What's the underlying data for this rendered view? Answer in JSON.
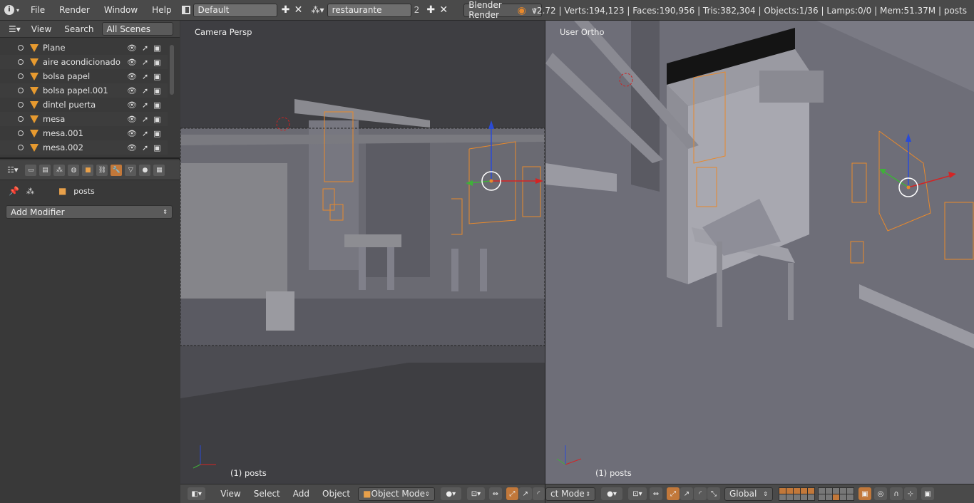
{
  "topbar": {
    "menus": [
      "File",
      "Render",
      "Window",
      "Help"
    ],
    "screen_layout": "Default",
    "scene": "restaurante",
    "scene_users": "2",
    "render_engine": "Blender Render",
    "stats": "v2.72 | Verts:194,123 | Faces:190,956 | Tris:382,304 | Objects:1/36 | Lamps:0/0 | Mem:51.37M | posts"
  },
  "outliner": {
    "menus": [
      "View",
      "Search"
    ],
    "display_mode": "All Scenes",
    "items": [
      {
        "name": "Plane"
      },
      {
        "name": "aire acondicionado"
      },
      {
        "name": "bolsa papel"
      },
      {
        "name": "bolsa papel.001"
      },
      {
        "name": "dintel puerta"
      },
      {
        "name": "mesa"
      },
      {
        "name": "mesa.001"
      },
      {
        "name": "mesa.002"
      }
    ]
  },
  "properties": {
    "object_name": "posts",
    "add_modifier_label": "Add Modifier"
  },
  "viewport_left": {
    "label": "Camera Persp",
    "selection": "(1) posts",
    "menus": [
      "View",
      "Select",
      "Add",
      "Object"
    ],
    "mode": "Object Mode"
  },
  "viewport_right": {
    "label": "User Ortho",
    "selection": "(1) posts",
    "mode": "ct Mode",
    "orientation": "Global"
  },
  "colors": {
    "accent": "#c2783a",
    "object_orange": "#e79a2f",
    "axis_x": "#d42424",
    "axis_y": "#3fb03a",
    "axis_z": "#2a4bd6"
  }
}
